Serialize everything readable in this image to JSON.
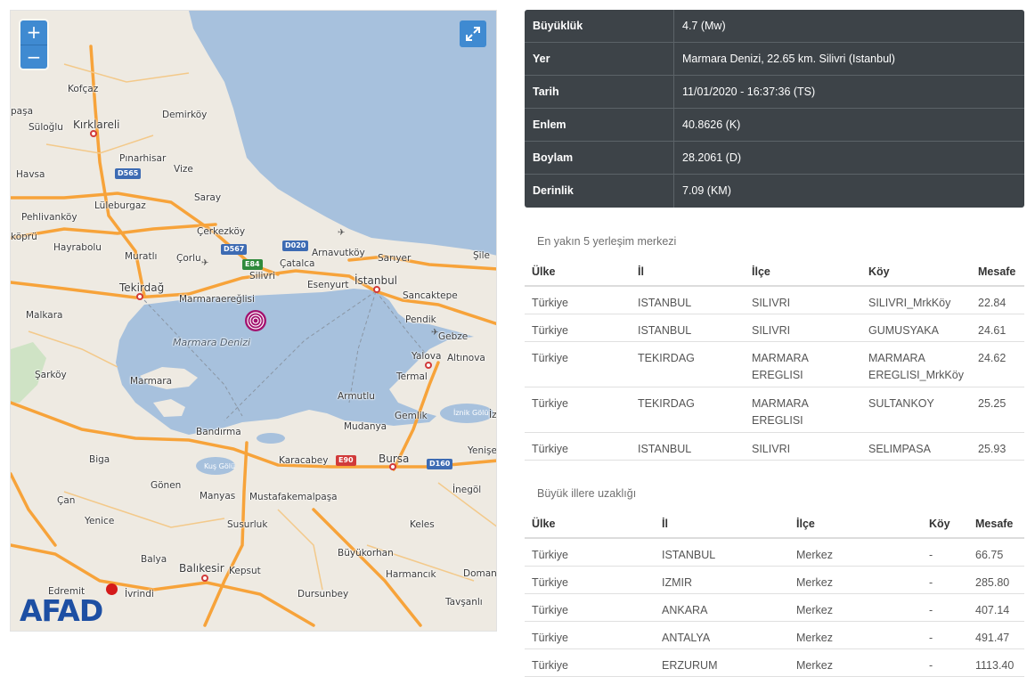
{
  "map": {
    "zoom_in": "+",
    "zoom_out": "−",
    "fullscreen_icon": "expand-icon",
    "sea_label": "Marmara Denizi",
    "logo": "AFAD",
    "lake_label": "İznik Gölü",
    "lake2_label": "Kuş Gölü",
    "roads": [
      "D565",
      "D567",
      "E84",
      "D020",
      "E90",
      "D160"
    ],
    "places": [
      "Kofçaz",
      "Kırklareli",
      "Demirköy",
      "paşa",
      "Süloğlu",
      "Pınarhisar",
      "Vize",
      "Havsa",
      "Pehlivanköy",
      "Lüleburgaz",
      "Saray",
      "köprü",
      "Çerkezköy",
      "Hayrabolu",
      "Muratlı",
      "Çorlu",
      "Silivri",
      "Arnavutköy",
      "Sarıyer",
      "Şile",
      "Çatalca",
      "Tekirdağ",
      "Marmaraereğlisi",
      "Esenyurt",
      "İstanbul",
      "Sancaktepe",
      "Malkara",
      "Pendik",
      "Gebze",
      "Yalova",
      "Altınova",
      "Şarköy",
      "Marmara",
      "Termal",
      "Armutlu",
      "Gemlik",
      "İz",
      "Mudanya",
      "Bandırma",
      "Yenişe",
      "Biga",
      "Karacabey",
      "Bursa",
      "İnegöl",
      "Gönen",
      "Manyas",
      "Mustafakemalpaşa",
      "Çan",
      "Yenice",
      "Susurluk",
      "Keles",
      "Büyükorhan",
      "Domani",
      "Balya",
      "Balıkesir",
      "Kepsut",
      "Harmancık",
      "Edremit",
      "İvrindi",
      "Dursunbey",
      "Tavşanlı"
    ]
  },
  "info": [
    {
      "key": "Büyüklük",
      "value": "4.7 (Mw)"
    },
    {
      "key": "Yer",
      "value": "Marmara Denizi, 22.65 km. Silivri (Istanbul)"
    },
    {
      "key": "Tarih",
      "value": "11/01/2020 - 16:37:36 (TS)"
    },
    {
      "key": "Enlem",
      "value": "40.8626 (K)"
    },
    {
      "key": "Boylam",
      "value": "28.2061 (D)"
    },
    {
      "key": "Derinlik",
      "value": "7.09 (KM)"
    }
  ],
  "nearest": {
    "title": "En yakın 5 yerleşim merkezi",
    "headers": [
      "Ülke",
      "İl",
      "İlçe",
      "Köy",
      "Mesafe"
    ],
    "rows": [
      [
        "Türkiye",
        "ISTANBUL",
        "SILIVRI",
        "SILIVRI_MrkKöy",
        "22.84"
      ],
      [
        "Türkiye",
        "ISTANBUL",
        "SILIVRI",
        "GUMUSYAKA",
        "24.61"
      ],
      [
        "Türkiye",
        "TEKIRDAG",
        "MARMARA EREGLISI",
        "MARMARA EREGLISI_MrkKöy",
        "24.62"
      ],
      [
        "Türkiye",
        "TEKIRDAG",
        "MARMARA EREGLISI",
        "SULTANKOY",
        "25.25"
      ],
      [
        "Türkiye",
        "ISTANBUL",
        "SILIVRI",
        "SELIMPASA",
        "25.93"
      ]
    ]
  },
  "cities": {
    "title": "Büyük illere uzaklığı",
    "headers": [
      "Ülke",
      "İl",
      "İlçe",
      "Köy",
      "Mesafe"
    ],
    "rows": [
      [
        "Türkiye",
        "ISTANBUL",
        "Merkez",
        "-",
        "66.75"
      ],
      [
        "Türkiye",
        "IZMIR",
        "Merkez",
        "-",
        "285.80"
      ],
      [
        "Türkiye",
        "ANKARA",
        "Merkez",
        "-",
        "407.14"
      ],
      [
        "Türkiye",
        "ANTALYA",
        "Merkez",
        "-",
        "491.47"
      ],
      [
        "Türkiye",
        "ERZURUM",
        "Merkez",
        "-",
        "1113.40"
      ]
    ]
  },
  "colors": {
    "panel_bg": "#3d4348",
    "water": "#a7c1dd",
    "highway": "#f7a33a",
    "accent_button": "#3f8ad1",
    "quake_marker": "#a3136f"
  }
}
